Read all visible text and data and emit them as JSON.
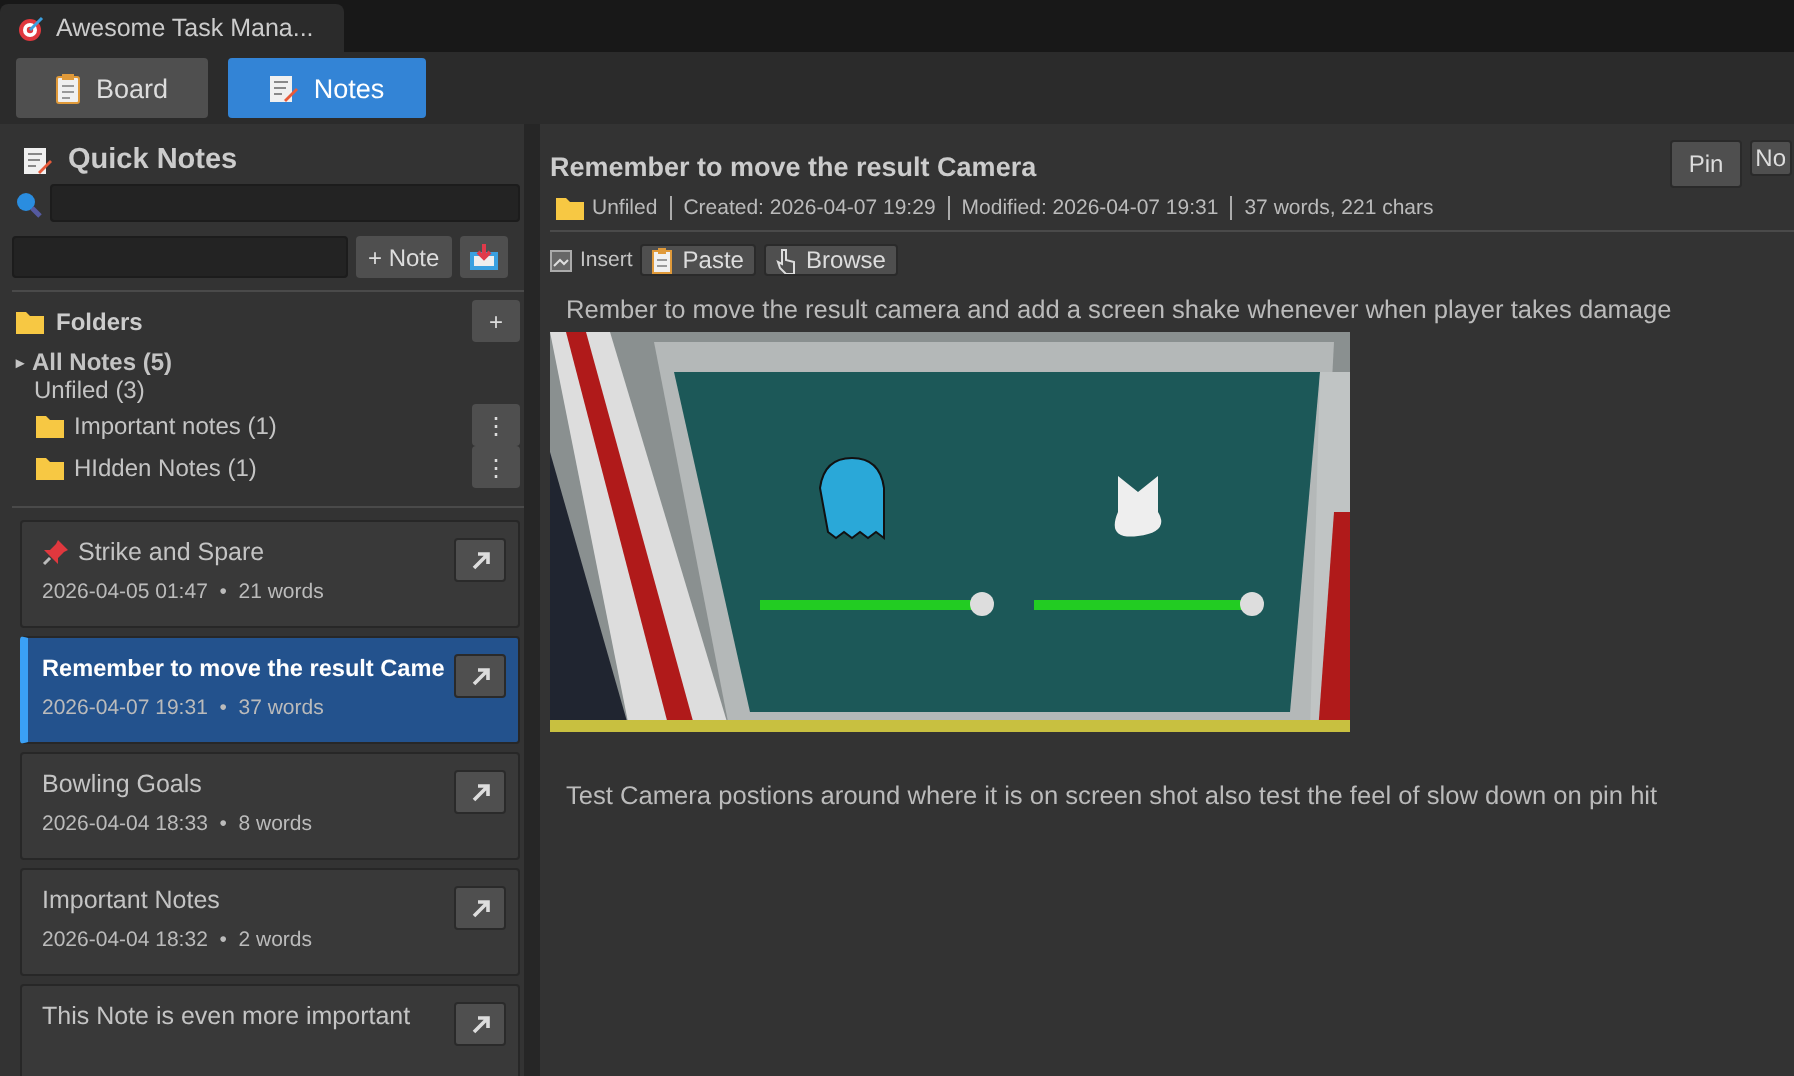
{
  "window": {
    "title": "Awesome Task Mana..."
  },
  "nav_tabs": [
    {
      "label": "Board",
      "kind": "board",
      "selected": false
    },
    {
      "label": "Notes",
      "kind": "notes",
      "selected": true
    }
  ],
  "sidebar": {
    "title": "Quick Notes",
    "add_button": "+ Note",
    "folders": {
      "title": "Folders",
      "add_button": "+",
      "items": [
        {
          "kind": "all",
          "toggle": "▸",
          "label": "All Notes (5)"
        },
        {
          "kind": "plain",
          "label": "Unfiled (3)"
        },
        {
          "kind": "folder",
          "label": "Important notes (1)",
          "menu": "⋮"
        },
        {
          "kind": "folder",
          "label": "HIdden Notes (1)",
          "menu": "⋮"
        }
      ]
    },
    "notes": [
      {
        "title": "Strike and Spare",
        "meta": "2026-04-05 01:47  •  21 words",
        "pinned": true,
        "selected": false
      },
      {
        "title": "Remember to move the result Came",
        "meta": "2026-04-07 19:31  •  37 words",
        "pinned": false,
        "selected": true
      },
      {
        "title": "Bowling Goals",
        "meta": "2026-04-04 18:33  •  8 words",
        "pinned": false,
        "selected": false
      },
      {
        "title": "Important Notes",
        "meta": "2026-04-04 18:32  •  2 words",
        "pinned": false,
        "selected": false
      },
      {
        "title": "This Note is even more important",
        "pinned": false,
        "selected": false
      }
    ]
  },
  "editor": {
    "title": "Remember to move the result Camera",
    "buttons": [
      "Pin",
      "No"
    ],
    "meta": {
      "folder": "Unfiled",
      "created": "Created: 2026-04-07 19:29",
      "modified": "Modified: 2026-04-07 19:31",
      "stats": "37 words, 221 chars"
    },
    "toolbar": {
      "label": "Insert",
      "buttons": [
        {
          "kind": "paste",
          "label": "Paste"
        },
        {
          "kind": "browse",
          "label": "Browse"
        }
      ]
    },
    "body": [
      {
        "kind": "text",
        "text": "Rember to move the result camera and add a screen shake whenever when player takes damage"
      },
      {
        "kind": "image"
      },
      {
        "kind": "text",
        "text": "Test Camera postions around where it is on screen shot also test the feel of slow down on pin hit"
      }
    ]
  }
}
